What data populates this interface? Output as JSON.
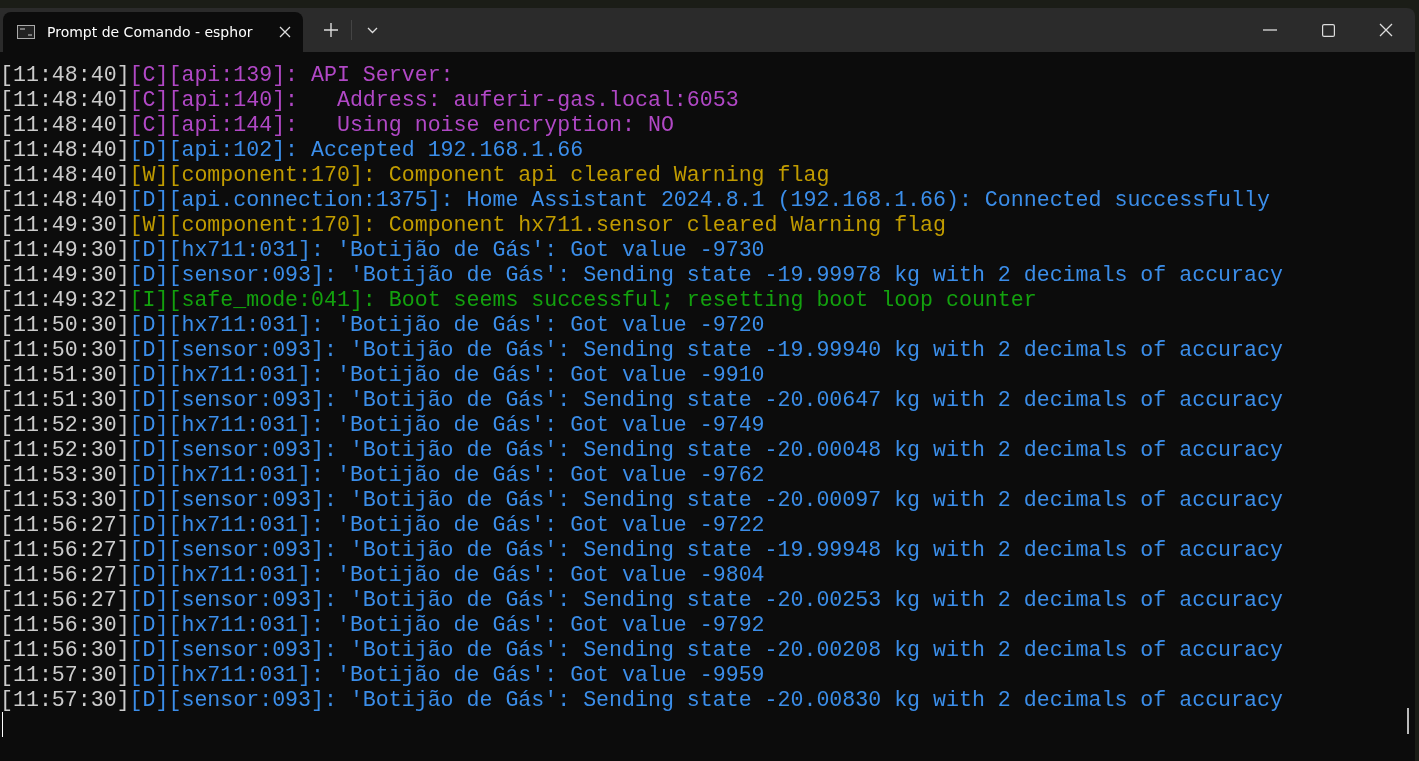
{
  "window": {
    "tab_title": "Prompt de Comando - esphor"
  },
  "lines": [
    {
      "time": "[11:48:40]",
      "kind": "config",
      "message": "[C][api:139]: API Server:"
    },
    {
      "time": "[11:48:40]",
      "kind": "config",
      "message": "[C][api:140]:   Address: auferir-gas.local:6053"
    },
    {
      "time": "[11:48:40]",
      "kind": "config",
      "message": "[C][api:144]:   Using noise encryption: NO"
    },
    {
      "time": "[11:48:40]",
      "kind": "debug",
      "message": "[D][api:102]: Accepted 192.168.1.66"
    },
    {
      "time": "[11:48:40]",
      "kind": "warning",
      "message": "[W][component:170]: Component api cleared Warning flag"
    },
    {
      "time": "[11:48:40]",
      "kind": "debug",
      "message": "[D][api.connection:1375]: Home Assistant 2024.8.1 (192.168.1.66): Connected successfully"
    },
    {
      "time": "[11:49:30]",
      "kind": "warning",
      "message": "[W][component:170]: Component hx711.sensor cleared Warning flag"
    },
    {
      "time": "[11:49:30]",
      "kind": "debug",
      "message": "[D][hx711:031]: 'Botijão de Gás': Got value -9730"
    },
    {
      "time": "[11:49:30]",
      "kind": "debug",
      "message": "[D][sensor:093]: 'Botijão de Gás': Sending state -19.99978 kg with 2 decimals of accuracy"
    },
    {
      "time": "[11:49:32]",
      "kind": "info",
      "message": "[I][safe_mode:041]: Boot seems successful; resetting boot loop counter"
    },
    {
      "time": "[11:50:30]",
      "kind": "debug",
      "message": "[D][hx711:031]: 'Botijão de Gás': Got value -9720"
    },
    {
      "time": "[11:50:30]",
      "kind": "debug",
      "message": "[D][sensor:093]: 'Botijão de Gás': Sending state -19.99940 kg with 2 decimals of accuracy"
    },
    {
      "time": "[11:51:30]",
      "kind": "debug",
      "message": "[D][hx711:031]: 'Botijão de Gás': Got value -9910"
    },
    {
      "time": "[11:51:30]",
      "kind": "debug",
      "message": "[D][sensor:093]: 'Botijão de Gás': Sending state -20.00647 kg with 2 decimals of accuracy"
    },
    {
      "time": "[11:52:30]",
      "kind": "debug",
      "message": "[D][hx711:031]: 'Botijão de Gás': Got value -9749"
    },
    {
      "time": "[11:52:30]",
      "kind": "debug",
      "message": "[D][sensor:093]: 'Botijão de Gás': Sending state -20.00048 kg with 2 decimals of accuracy"
    },
    {
      "time": "[11:53:30]",
      "kind": "debug",
      "message": "[D][hx711:031]: 'Botijão de Gás': Got value -9762"
    },
    {
      "time": "[11:53:30]",
      "kind": "debug",
      "message": "[D][sensor:093]: 'Botijão de Gás': Sending state -20.00097 kg with 2 decimals of accuracy"
    },
    {
      "time": "[11:56:27]",
      "kind": "debug",
      "message": "[D][hx711:031]: 'Botijão de Gás': Got value -9722"
    },
    {
      "time": "[11:56:27]",
      "kind": "debug",
      "message": "[D][sensor:093]: 'Botijão de Gás': Sending state -19.99948 kg with 2 decimals of accuracy"
    },
    {
      "time": "[11:56:27]",
      "kind": "debug",
      "message": "[D][hx711:031]: 'Botijão de Gás': Got value -9804"
    },
    {
      "time": "[11:56:27]",
      "kind": "debug",
      "message": "[D][sensor:093]: 'Botijão de Gás': Sending state -20.00253 kg with 2 decimals of accuracy"
    },
    {
      "time": "[11:56:30]",
      "kind": "debug",
      "message": "[D][hx711:031]: 'Botijão de Gás': Got value -9792"
    },
    {
      "time": "[11:56:30]",
      "kind": "debug",
      "message": "[D][sensor:093]: 'Botijão de Gás': Sending state -20.00208 kg with 2 decimals of accuracy"
    },
    {
      "time": "[11:57:30]",
      "kind": "debug",
      "message": "[D][hx711:031]: 'Botijão de Gás': Got value -9959"
    },
    {
      "time": "[11:57:30]",
      "kind": "debug",
      "message": "[D][sensor:093]: 'Botijão de Gás': Sending state -20.00830 kg with 2 decimals of accuracy"
    }
  ]
}
